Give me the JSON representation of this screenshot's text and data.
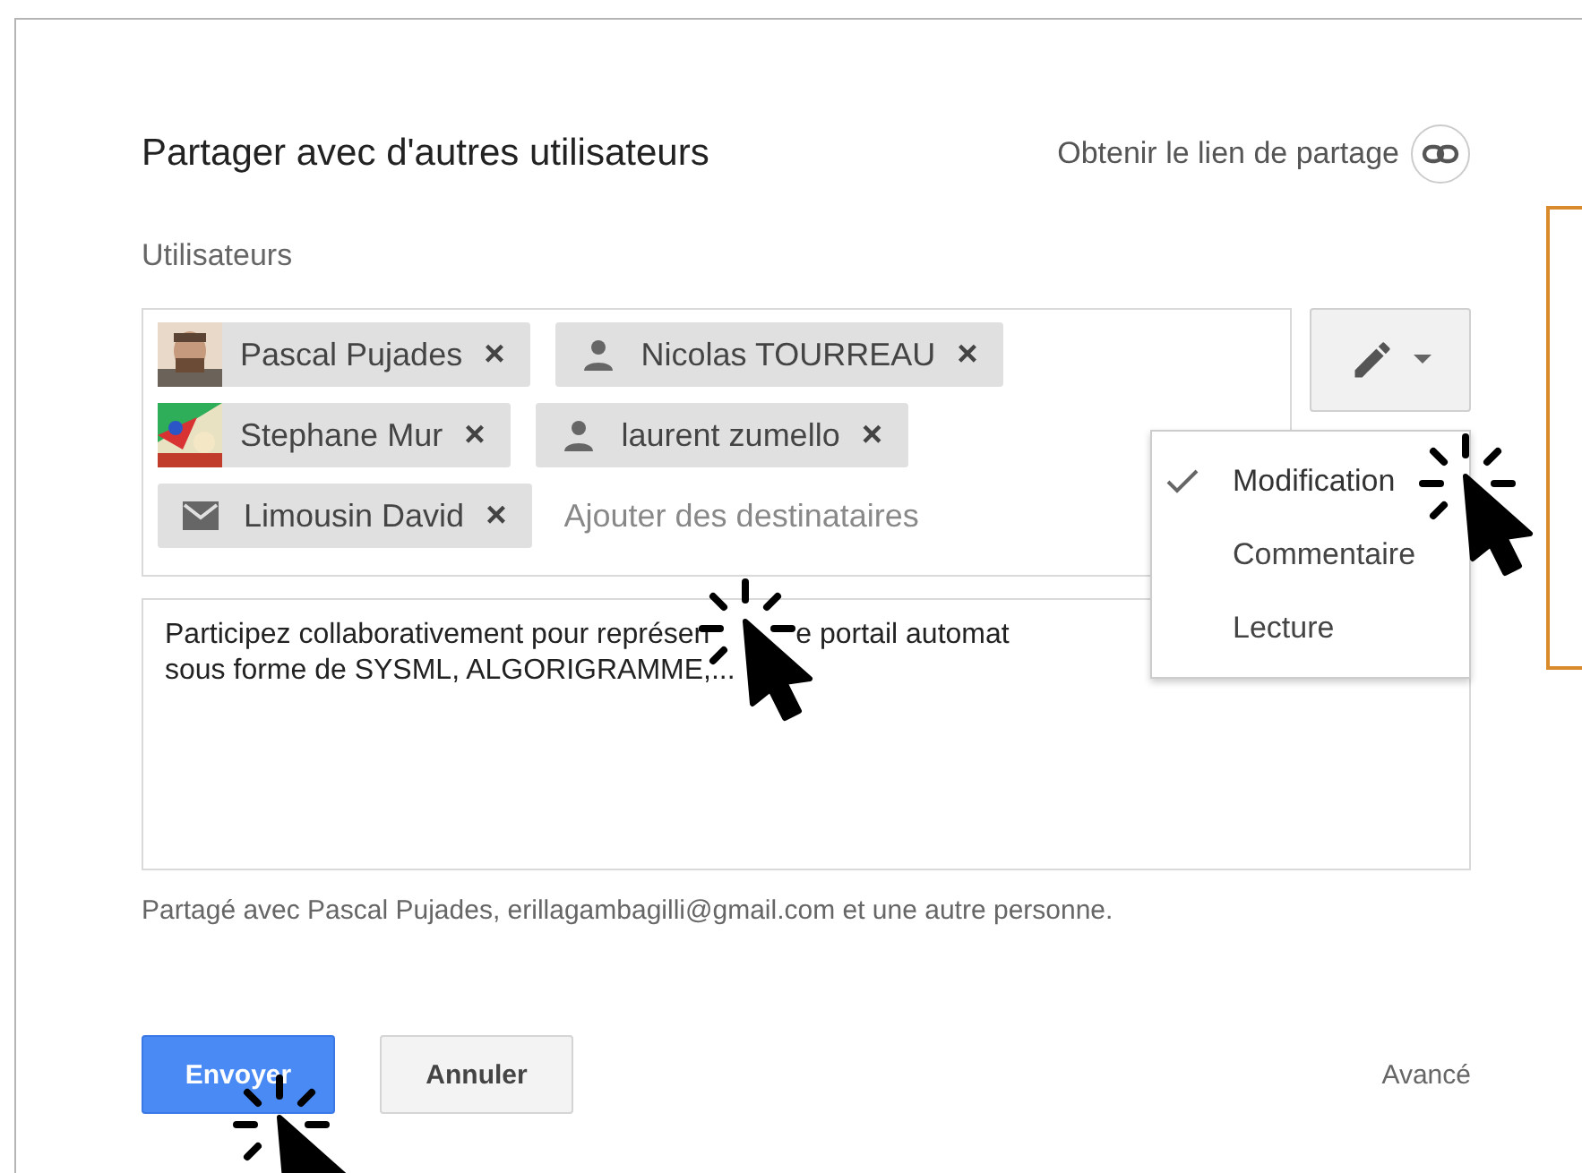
{
  "dialog": {
    "title": "Partager avec d'autres utilisateurs",
    "share_link": "Obtenir le lien de partage"
  },
  "users_label": "Utilisateurs",
  "recipients": [
    {
      "name": "Pascal Pujades",
      "remove": "×"
    },
    {
      "name": "Nicolas TOURREAU",
      "kind": "person",
      "remove": "×"
    },
    {
      "name": "Stephane Mur",
      "remove": "×"
    },
    {
      "name": "laurent zumello",
      "kind": "person",
      "remove": "×"
    },
    {
      "name": "Limousin David",
      "kind": "mail",
      "remove": "×"
    }
  ],
  "recipient_field": {
    "placeholder": "Ajouter des destinataires"
  },
  "permission_menu": [
    {
      "label": "Modification",
      "selected": true
    },
    {
      "label": "Commentaire",
      "selected": false
    },
    {
      "label": "Lecture",
      "selected": false
    }
  ],
  "message": {
    "lines": [
      [
        "Participez collaborativement pour représen",
        "e portail automat"
      ],
      [
        "sous forme de SYSML, ALGORIGRAMME,..."
      ]
    ]
  },
  "shared_with": "Partagé avec Pascal Pujades, erillagambagilli@gmail.com et une autre personne.",
  "buttons": {
    "send": "Envoyer",
    "cancel": "Annuler",
    "advanced": "Avancé"
  }
}
